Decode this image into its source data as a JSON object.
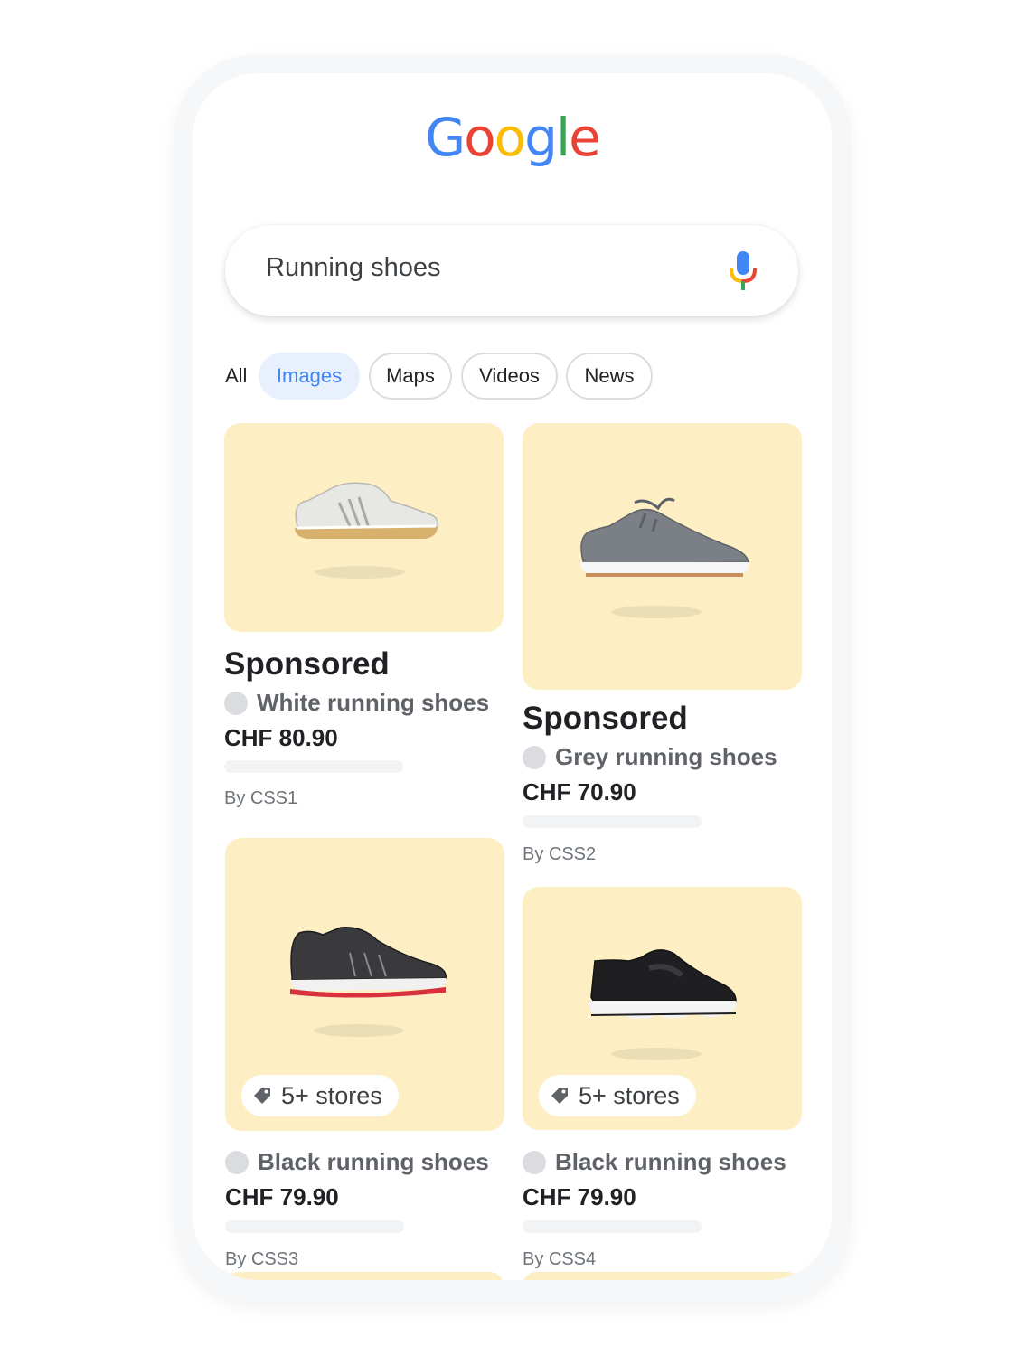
{
  "logo": {
    "letters": [
      {
        "char": "G",
        "color": "#4285F4"
      },
      {
        "char": "o",
        "color": "#EA4335"
      },
      {
        "char": "o",
        "color": "#FBBC05"
      },
      {
        "char": "g",
        "color": "#4285F4"
      },
      {
        "char": "l",
        "color": "#34A853"
      },
      {
        "char": "e",
        "color": "#EA4335"
      }
    ]
  },
  "search": {
    "query": "Running shoes",
    "mic_icon": "microphone-icon"
  },
  "tabs": {
    "all": "All",
    "images": "Images",
    "maps": "Maps",
    "videos": "Videos",
    "news": "News",
    "active": "Images"
  },
  "colors": {
    "card_background": "#FDEFC3",
    "active_chip_bg": "#E8F0FE",
    "active_chip_text": "#4285F4"
  },
  "results": [
    {
      "sponsored": "Sponsored",
      "title": "White running shoes",
      "price": "CHF 80.90",
      "by": "By CSS1",
      "shoe_icon": "white-sneaker-image"
    },
    {
      "sponsored": "Sponsored",
      "title": "Grey running shoes",
      "price": "CHF 70.90",
      "by": "By CSS2",
      "shoe_icon": "grey-sneaker-image"
    },
    {
      "badge": "5+ stores",
      "badge_icon": "tag-icon",
      "title": "Black running shoes",
      "price": "CHF 79.90",
      "by": "By CSS3",
      "shoe_icon": "black-red-sneaker-image"
    },
    {
      "badge": "5+ stores",
      "badge_icon": "tag-icon",
      "title": "Black running shoes",
      "price": "CHF 79.90",
      "by": "By CSS4",
      "shoe_icon": "black-slipon-sneaker-image"
    }
  ]
}
